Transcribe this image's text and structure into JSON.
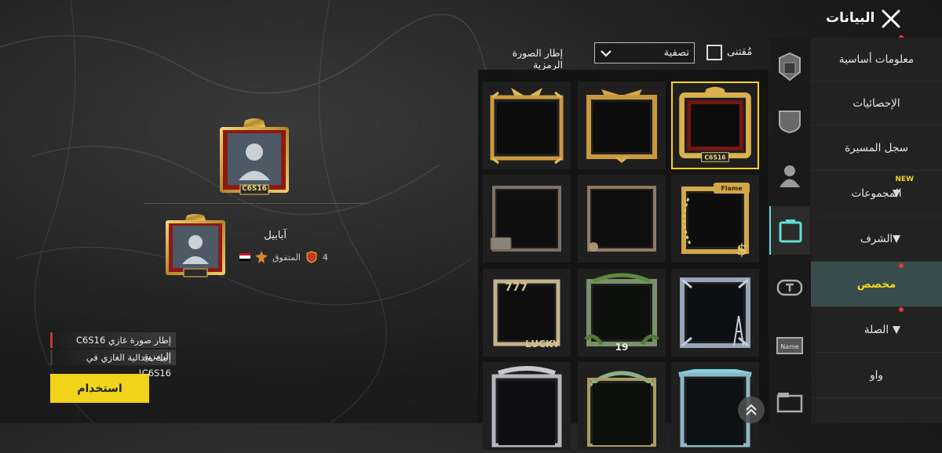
{
  "header": {
    "title": "البيانات"
  },
  "sidebar": {
    "items": [
      {
        "label": "معلومات أساسية"
      },
      {
        "label": "الإحصائيات"
      },
      {
        "label": "سجل المسيرة"
      },
      {
        "label": "المجموعات",
        "badge": "NEW"
      },
      {
        "label": "الشرف"
      },
      {
        "label": "مخصص"
      },
      {
        "label": "الصلة"
      },
      {
        "label": "واو"
      }
    ]
  },
  "icon_column": [
    "helmet-icon",
    "shield-icon",
    "person-icon",
    "frame-icon",
    "nameplate-icon",
    "name-card-icon",
    "folder-icon"
  ],
  "grid": {
    "title": "إطار الصورة الرمزية",
    "filter": "تصفية",
    "owned_label": "مُقتنى",
    "frames": [
      {
        "name": "c6s16-gold-frame",
        "caption": "C6S16"
      },
      {
        "name": "winged-gold-frame"
      },
      {
        "name": "crown-gold-frame"
      },
      {
        "name": "chain-gold-frame",
        "caption": "Flame"
      },
      {
        "name": "simple-dark-frame"
      },
      {
        "name": "briefcase-frame"
      },
      {
        "name": "steel-eiffel-frame"
      },
      {
        "name": "green-leaf-frame",
        "caption": "19"
      },
      {
        "name": "lucky-frame",
        "caption": "LUCKY"
      },
      {
        "name": "teal-frame"
      },
      {
        "name": "green-arch-frame"
      },
      {
        "name": "silver-frame"
      }
    ]
  },
  "preview": {
    "player_name": "آبابيل",
    "level": "4",
    "title": "المتفوق",
    "frame_caption": "C6S16"
  },
  "notice": {
    "line1": "إطار صورة غازي C6S16 الرمزية",
    "line2": "إليك ميدالية الغازي في C6S16!"
  },
  "use_button": "استخدام",
  "colors": {
    "accent": "#f2d31b",
    "active_tab": "#394c4c",
    "notification": "#e53935"
  }
}
